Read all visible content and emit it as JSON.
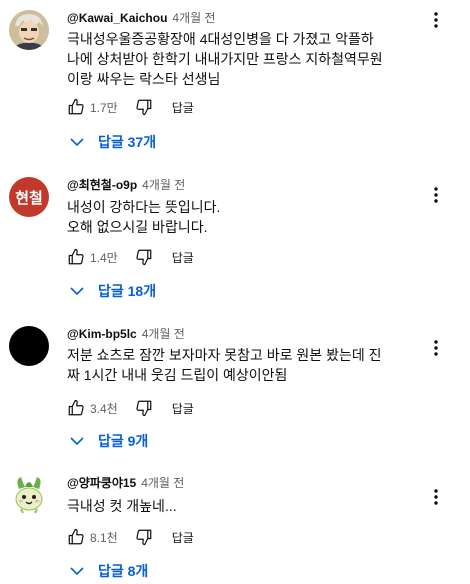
{
  "comments": [
    {
      "author": "@Kawai_Kaichou",
      "time": "4개월 전",
      "lines": [
        "극내성우울증공황장애 4대성인병을 다 가졌고 악플하",
        "나에 상처받아 한학기 내내가지만 프랑스 지하철역무원",
        "이랑 싸우는 락스타 선생님"
      ],
      "likes": "1.7만",
      "reply_label": "답글",
      "replies_label": "답글 37개",
      "avatar_icon": "anime-character-avatar"
    },
    {
      "author": "@최현철-o9p",
      "time": "4개월 전",
      "lines": [
        "내성이 강하다는 뜻입니다.",
        "오해 없으시길 바랍니다."
      ],
      "likes": "1.4만",
      "reply_label": "답글",
      "replies_label": "답글 18개",
      "avatar_text": "현철",
      "avatar_color": "#c0392b"
    },
    {
      "author": "@Kim-bp5lc",
      "time": "4개월 전",
      "lines": [
        "저분 쇼츠로 잠깐 보자마자 못참고 바로 원본 봤는데 진",
        "짜 1시간 내내 웃김 드립이 예상이안됨"
      ],
      "likes": "3.4천",
      "reply_label": "답글",
      "replies_label": "답글 9개",
      "avatar_color": "#000000"
    },
    {
      "author": "@양파쿵야15",
      "time": "4개월 전",
      "lines": [
        "극내성 컷 개높네..."
      ],
      "likes": "8.1천",
      "reply_label": "답글",
      "replies_label": "답글 8개",
      "avatar_icon": "green-onion-character-avatar"
    }
  ],
  "colors": {
    "link": "#065fd4",
    "meta": "#606060",
    "text": "#0f0f0f"
  }
}
